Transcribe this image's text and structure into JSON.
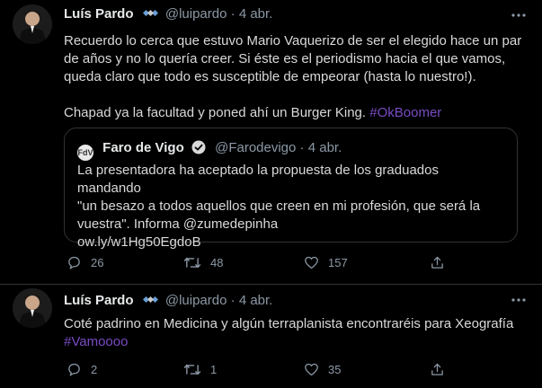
{
  "tweets": [
    {
      "author_name": "Luís Pardo",
      "author_handle": "@luipardo",
      "separator": "·",
      "date": "4 abr.",
      "text_line1": "Recuerdo lo cerca que estuvo Mario Vaquerizo de ser el elegido hace un par",
      "text_line2": "de años y no lo quería creer. Si éste es el periodismo hacia el que vamos,",
      "text_line3": "queda claro que todo es susceptible de empeorar (hasta lo nuestro!).",
      "text_line4": "Chapad ya la facultad y poned ahí un Burger King.",
      "hashtag": "#OkBoomer",
      "quote": {
        "logo_text": "FdV",
        "name": "Faro de Vigo",
        "handle": "@Farodevigo",
        "separator": "·",
        "date": "4 abr.",
        "text_line1": "La presentadora ha aceptado la propuesta de los graduados mandando",
        "text_line2": "\"un besazo a todos aquellos que creen en mi profesión, que será la",
        "text_line3": "vuestra\". Informa @zumedepinha",
        "link": "ow.ly/w1Hg50EgdoB"
      },
      "replies": "26",
      "retweets": "48",
      "likes": "157"
    },
    {
      "author_name": "Luís Pardo",
      "author_handle": "@luipardo",
      "separator": "·",
      "date": "4 abr.",
      "text_line1": "Coté padrino en Medicina y algún terraplanista encontraréis para Xeografía",
      "hashtag": "#Vamoooo",
      "replies": "2",
      "retweets": "1",
      "likes": "35"
    }
  ],
  "icons": {
    "more": "more-icon",
    "satellite": "satellite-icon",
    "verified": "verified-icon",
    "reply": "reply-icon",
    "retweet": "retweet-icon",
    "like": "like-icon",
    "share": "share-icon"
  },
  "colors": {
    "background": "#000000",
    "text": "#d9d9d9",
    "secondary": "#8b98a5",
    "hashtag": "#794bc4",
    "border": "#2f3336"
  }
}
